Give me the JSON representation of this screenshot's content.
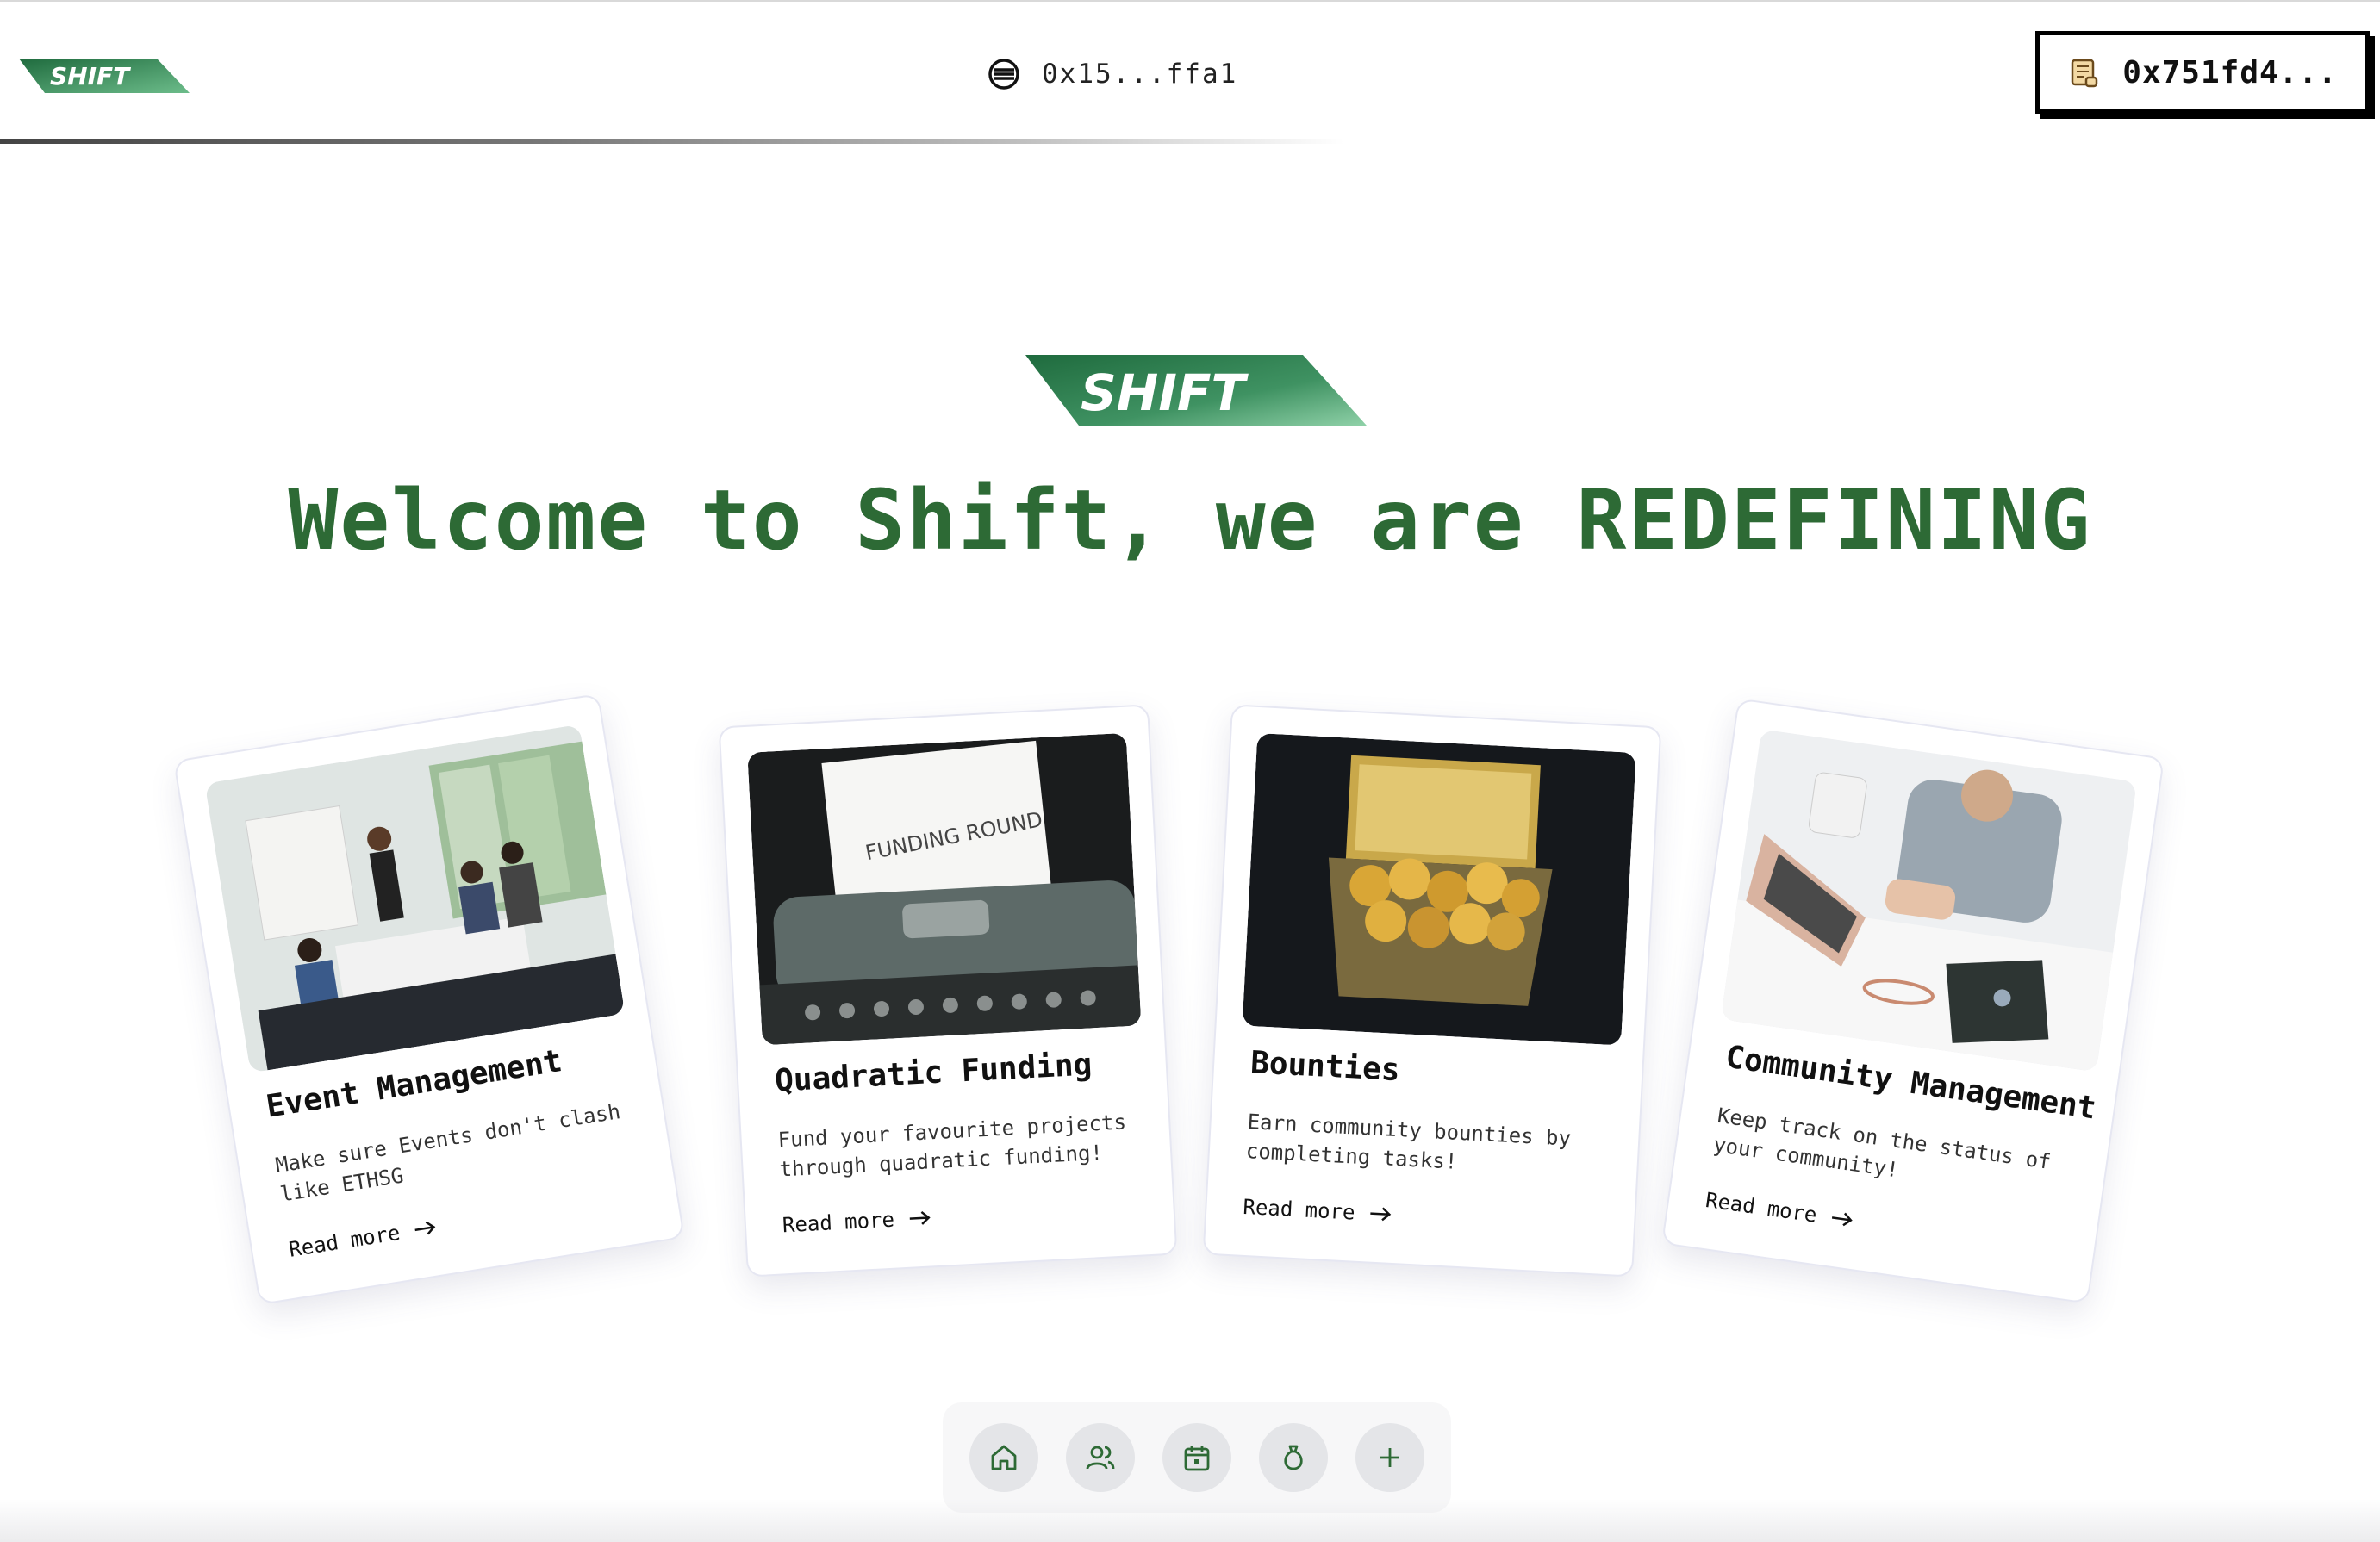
{
  "brand": {
    "logo_text": "SHIFT",
    "accent_color": "#2d6a35",
    "logo_gradient": [
      "#1f6b3e",
      "#5fb07e"
    ]
  },
  "topbar": {
    "network_icon": "network-coin-icon",
    "center_address": "0x15...ffa1",
    "wallet_icon": "scroll-icon",
    "wallet_address": "0x751fd4..."
  },
  "hero": {
    "headline": "Welcome to Shift, we are REDEFINING"
  },
  "cards": [
    {
      "title": "Event Management",
      "description": "Make sure Events don't clash like ETHSG",
      "link_label": "Read more",
      "image": "photo of a business presentation in a meeting room"
    },
    {
      "title": "Quadratic Funding",
      "description": "Fund your favourite projects through quadratic funding!",
      "link_label": "Read more",
      "image": "typewriter with paper",
      "image_text": "FUNDING ROUND"
    },
    {
      "title": "Bounties",
      "description": "Earn community bounties by completing tasks!",
      "link_label": "Read more",
      "image": "gold coins in a metal tin"
    },
    {
      "title": "Community Management",
      "description": "Keep track on the status of your community!",
      "link_label": "Read more",
      "image": "person with laptop and coffee mug"
    }
  ],
  "bottom_nav": {
    "items": [
      {
        "icon": "home-icon"
      },
      {
        "icon": "users-icon"
      },
      {
        "icon": "calendar-icon"
      },
      {
        "icon": "money-bag-icon"
      },
      {
        "icon": "plus-icon"
      }
    ]
  }
}
